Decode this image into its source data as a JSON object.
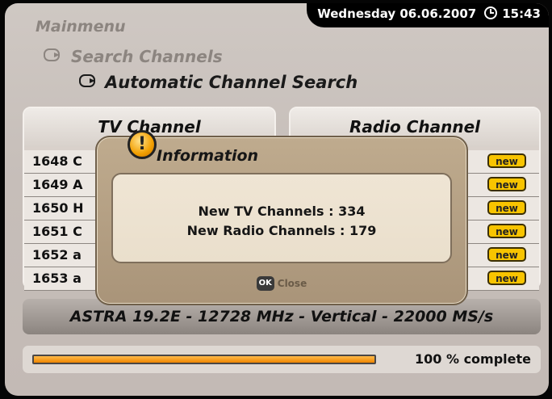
{
  "header": {
    "date": "Wednesday 06.06.2007",
    "time": "15:43"
  },
  "breadcrumb": {
    "level1": "Mainmenu",
    "level2": "Search Channels",
    "level3": "Automatic Channel Search"
  },
  "tv_panel": {
    "title": "TV Channel",
    "rows": [
      {
        "number": "1648",
        "name": "C"
      },
      {
        "number": "1649",
        "name": "A"
      },
      {
        "number": "1650",
        "name": "H"
      },
      {
        "number": "1651",
        "name": "C"
      },
      {
        "number": "1652",
        "name": "a"
      },
      {
        "number": "1653",
        "name": "a"
      }
    ]
  },
  "radio_panel": {
    "title": "Radio Channel",
    "rows": [
      {
        "badge": "new"
      },
      {
        "badge": "new"
      },
      {
        "badge": "new"
      },
      {
        "badge": "new"
      },
      {
        "badge": "new"
      },
      {
        "badge": "new"
      }
    ]
  },
  "dialog": {
    "title": "Information",
    "line1": "New TV Channels : 334",
    "line2": "New Radio Channels : 179",
    "ok_key": "OK",
    "close_label": "Close"
  },
  "status": {
    "transponder": "ASTRA 19.2E - 12728 MHz - Vertical - 22000 MS/s"
  },
  "progress": {
    "percent": 100,
    "label": "100 % complete"
  },
  "colors": {
    "accent": "#f8c400",
    "progress_fill": "#f29000",
    "dialog_bg": "#b29e82"
  },
  "icons": {
    "clock": "clock-icon",
    "warning": "warning-icon",
    "nav": "arrow-icon",
    "ok": "ok-button-icon"
  }
}
